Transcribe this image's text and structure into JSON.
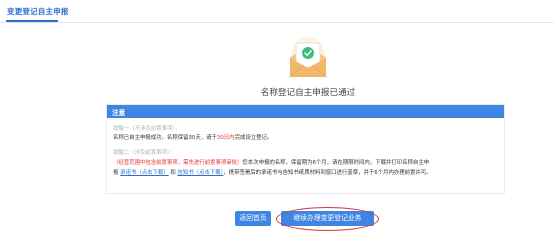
{
  "header": {
    "title": "变更登记自主申报"
  },
  "result": {
    "message": "名称登记自主申报已通过"
  },
  "notice": {
    "title": "注意",
    "step1_label": "提醒一（不涉及前置事项）：",
    "step1_text": "名称已自主申报成功，名称保留30天，请于",
    "step1_highlight": "30日内",
    "step1_tail": "完成设立登记。",
    "step2_label": "提醒二（涉及前置事项）：",
    "step2_red": "（经营范围中包含前置事项，需先进行前置事项审批）",
    "step2_text": "您本次申报的名称，保留期为6个月，请在期限时间内，下载并打印名称自主申",
    "step3_pre": "报",
    "link1": "承诺书（点击下载）",
    "link_sep": "和",
    "link2": "告知书（点击下载）",
    "step3_tail": "，携带签署后的承诺书与告知书纸质材料到窗口进行盖章，并于6个月内办理前置许可。"
  },
  "buttons": {
    "back": "返回首页",
    "continue": "继续办理变更登记业务"
  },
  "colors": {
    "accent": "#3d86e6",
    "header_bar": "#3e86e4",
    "warning_red": "#e33232",
    "highlight_ring": "#d23a3a"
  },
  "icons": {
    "illustration": "envelope-check-icon"
  }
}
